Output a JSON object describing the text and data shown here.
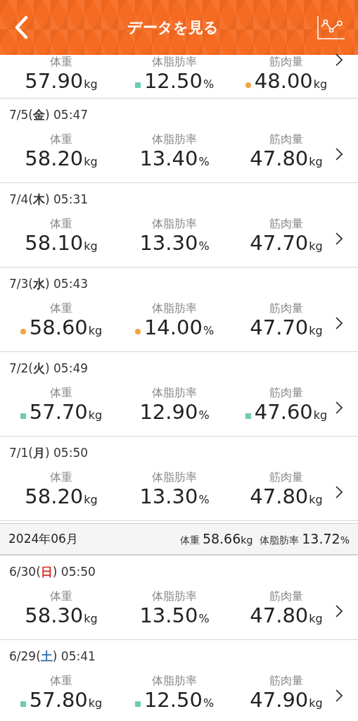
{
  "header": {
    "title": "データを見る"
  },
  "groups": [
    {
      "entries": [
        {
          "metrics": [
            {
              "label": "体重",
              "value": "57.90",
              "unit": "kg",
              "square_mark": false,
              "dot_mark": false
            },
            {
              "label": "体脂肪率",
              "value": "12.50",
              "unit": "%",
              "square_mark": true,
              "dot_mark": false
            },
            {
              "label": "筋肉量",
              "value": "48.00",
              "unit": "kg",
              "square_mark": false,
              "dot_mark": true
            }
          ]
        },
        {
          "date": "7/5(",
          "weekday": {
            "text": "金",
            "color": "#333333"
          },
          "time": ") 05:47",
          "metrics": [
            {
              "label": "体重",
              "value": "58.20",
              "unit": "kg",
              "square_mark": false,
              "dot_mark": false
            },
            {
              "label": "体脂肪率",
              "value": "13.40",
              "unit": "%",
              "square_mark": false,
              "dot_mark": false
            },
            {
              "label": "筋肉量",
              "value": "47.80",
              "unit": "kg",
              "square_mark": false,
              "dot_mark": false
            }
          ]
        },
        {
          "date": "7/4(",
          "weekday": {
            "text": "木",
            "color": "#333333"
          },
          "time": ") 05:31",
          "metrics": [
            {
              "label": "体重",
              "value": "58.10",
              "unit": "kg",
              "square_mark": false,
              "dot_mark": false
            },
            {
              "label": "体脂肪率",
              "value": "13.30",
              "unit": "%",
              "square_mark": false,
              "dot_mark": false
            },
            {
              "label": "筋肉量",
              "value": "47.70",
              "unit": "kg",
              "square_mark": false,
              "dot_mark": false
            }
          ]
        },
        {
          "date": "7/3(",
          "weekday": {
            "text": "水",
            "color": "#333333"
          },
          "time": ") 05:43",
          "metrics": [
            {
              "label": "体重",
              "value": "58.60",
              "unit": "kg",
              "square_mark": false,
              "dot_mark": true
            },
            {
              "label": "体脂肪率",
              "value": "14.00",
              "unit": "%",
              "square_mark": false,
              "dot_mark": true
            },
            {
              "label": "筋肉量",
              "value": "47.70",
              "unit": "kg",
              "square_mark": false,
              "dot_mark": false
            }
          ]
        },
        {
          "date": "7/2(",
          "weekday": {
            "text": "火",
            "color": "#333333"
          },
          "time": ") 05:49",
          "metrics": [
            {
              "label": "体重",
              "value": "57.70",
              "unit": "kg",
              "square_mark": true,
              "dot_mark": false
            },
            {
              "label": "体脂肪率",
              "value": "12.90",
              "unit": "%",
              "square_mark": false,
              "dot_mark": false
            },
            {
              "label": "筋肉量",
              "value": "47.60",
              "unit": "kg",
              "square_mark": true,
              "dot_mark": false
            }
          ]
        },
        {
          "date": "7/1(",
          "weekday": {
            "text": "月",
            "color": "#333333"
          },
          "time": ") 05:50",
          "metrics": [
            {
              "label": "体重",
              "value": "58.20",
              "unit": "kg",
              "square_mark": false,
              "dot_mark": false
            },
            {
              "label": "体脂肪率",
              "value": "13.30",
              "unit": "%",
              "square_mark": false,
              "dot_mark": false
            },
            {
              "label": "筋肉量",
              "value": "47.80",
              "unit": "kg",
              "square_mark": false,
              "dot_mark": false
            }
          ]
        }
      ]
    },
    {
      "month": "2024年06月",
      "summary": [
        {
          "label": "体重",
          "value": "58.66",
          "unit": "kg"
        },
        {
          "label": "体脂肪率",
          "value": "13.72",
          "unit": "%"
        }
      ],
      "entries": [
        {
          "date": "6/30(",
          "weekday": {
            "text": "日",
            "color": "#d9302c"
          },
          "time": ") 05:50",
          "metrics": [
            {
              "label": "体重",
              "value": "58.30",
              "unit": "kg",
              "square_mark": false,
              "dot_mark": false
            },
            {
              "label": "体脂肪率",
              "value": "13.50",
              "unit": "%",
              "square_mark": false,
              "dot_mark": false
            },
            {
              "label": "筋肉量",
              "value": "47.80",
              "unit": "kg",
              "square_mark": false,
              "dot_mark": false
            }
          ]
        },
        {
          "date": "6/29(",
          "weekday": {
            "text": "土",
            "color": "#2f6fa8"
          },
          "time": ") 05:41",
          "metrics": [
            {
              "label": "体重",
              "value": "57.80",
              "unit": "kg",
              "square_mark": true,
              "dot_mark": false
            },
            {
              "label": "体脂肪率",
              "value": "12.50",
              "unit": "%",
              "square_mark": true,
              "dot_mark": false
            },
            {
              "label": "筋肉量",
              "value": "47.90",
              "unit": "kg",
              "square_mark": false,
              "dot_mark": false
            }
          ]
        }
      ]
    }
  ]
}
